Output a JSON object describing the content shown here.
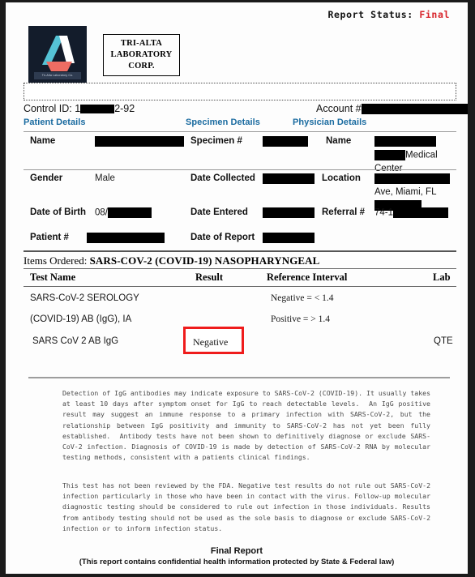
{
  "header": {
    "status_label": "Report Status:",
    "status_value": "Final",
    "status_color": "#d8232a",
    "logo_caption": "Tri-Alta Laboratory Co.",
    "lab_name_line1": "TRI-ALTA",
    "lab_name_line2": "LABORATORY",
    "lab_name_line3": "CORP."
  },
  "identity": {
    "control_id_label": "Control ID:",
    "control_id_prefix": "1",
    "control_id_suffix": "2-92",
    "account_label": "Account #"
  },
  "sections": {
    "patient": "Patient Details",
    "specimen": "Specimen Details",
    "physician": "Physician Details",
    "heading_color": "#1a6ba0"
  },
  "patient": {
    "name_label": "Name",
    "name_value": "",
    "gender_label": "Gender",
    "gender_value": "Male",
    "dob_label": "Date of Birth",
    "dob_value": "08/",
    "patient_num_label": "Patient #",
    "patient_num_value": ""
  },
  "specimen": {
    "specimen_num_label": "Specimen #",
    "specimen_num_value": "",
    "date_collected_label": "Date Collected",
    "date_collected_value": "",
    "date_entered_label": "Date Entered",
    "date_entered_value": "",
    "date_report_label": "Date of Report",
    "date_report_value": ""
  },
  "physician": {
    "name_label": "Name",
    "name_line2_suffix": "Medical",
    "name_line3": "Center",
    "location_label": "Location",
    "location_line2_suffix": "Ave, Miami, FL",
    "referral_label": "Referral #",
    "referral_prefix": "74-1"
  },
  "order": {
    "items_ordered_label": "Items Ordered:",
    "items_ordered_value": "SARS-COV-2 (COVID-19) NASOPHARYNGEAL"
  },
  "table": {
    "columns": [
      "Test Name",
      "Result",
      "Reference Interval",
      "Lab"
    ],
    "rows": [
      {
        "test_name": "SARS-CoV-2 SEROLOGY",
        "result": "",
        "reference_interval": "Negative = < 1.4",
        "lab": ""
      },
      {
        "test_name": "(COVID-19) AB (IgG), IA",
        "result": "",
        "reference_interval": "Positive = > 1.4",
        "lab": ""
      },
      {
        "test_name": "SARS CoV 2 AB IgG",
        "result": "Negative",
        "reference_interval": "",
        "lab": "QTE"
      }
    ],
    "highlight_color": "#ef1c1c"
  },
  "disclaimer": {
    "paragraph1": "Detection of IgG antibodies may indicate exposure to SARS-CoV-2 (COVID-19). It usually takes at least 10 days after symptom onset for IgG to reach detectable levels.  An IgG positive result may suggest an immune response to a primary infection with SARS-CoV-2, but the relationship between IgG positivity and immunity to SARS-CoV-2 has not yet been fully established.  Antibody tests have not been shown to definitively diagnose or exclude SARS-CoV-2 infection. Diagnosis of COVID-19 is made by detection of SARS-CoV-2 RNA by molecular testing methods, consistent with a patients clinical findings.",
    "paragraph2": "This test has not been reviewed by the FDA. Negative test results do not rule out SARS-CoV-2 infection particularly in those who have been in contact with the virus. Follow-up molecular diagnostic testing should be considered to rule out infection in those individuals. Results from antibody testing should not be used as the sole basis to diagnose or exclude SARS-CoV-2 infection or to inform infection status."
  },
  "footer": {
    "title": "Final Report",
    "subtitle": "(This report contains confidential health information protected by State & Federal law)"
  }
}
